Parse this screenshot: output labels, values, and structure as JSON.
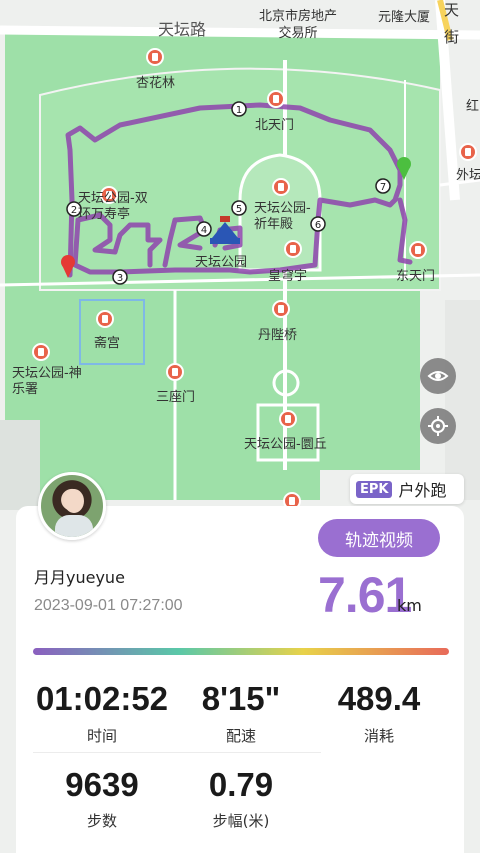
{
  "map": {
    "labels": {
      "tiantan_road": "天坛路",
      "real_estate": "北京市房地产交易所",
      "yuanlong": "元隆大厦",
      "xinghualin": "杏花林",
      "north_gate": "北天门",
      "west_altar": "外坛",
      "park_shuang": "天坛公园-双环万寿亭",
      "park_qinian": "天坛公园-祈年殿",
      "park_main": "天坛公园",
      "huangqiong": "皇穹宇",
      "east_gate": "东天门",
      "danbi": "丹陛桥",
      "zhaigong": "斋宫",
      "shenyue": "天坛公园-神乐署",
      "sanzuomen": "三座门",
      "yuanqiu": "天坛公园-圜丘",
      "hong": "红",
      "tian": "天",
      "jie": "街"
    },
    "route_markers": [
      "1",
      "2",
      "3",
      "4",
      "5",
      "6",
      "7"
    ],
    "eye_icon": "eye-icon",
    "locate_icon": "crosshair-icon"
  },
  "badge": {
    "logo": "EPK",
    "label": "户外跑"
  },
  "profile": {
    "username": "月月yueyue",
    "timestamp": "2023-09-01 07:27:00",
    "track_button": "轨迹视频"
  },
  "summary": {
    "distance": "7.61",
    "unit": "km"
  },
  "stats": [
    {
      "value": "01:02:52",
      "label": "时间"
    },
    {
      "value": "8'15\"",
      "label": "配速"
    },
    {
      "value": "489.4",
      "label": "消耗"
    },
    {
      "value": "9639",
      "label": "步数"
    },
    {
      "value": "0.79",
      "label": "步幅(米)"
    }
  ],
  "colors": {
    "accent": "#9a6fd1",
    "park_green": "#9ee0a8",
    "route": "#8e44ad"
  }
}
